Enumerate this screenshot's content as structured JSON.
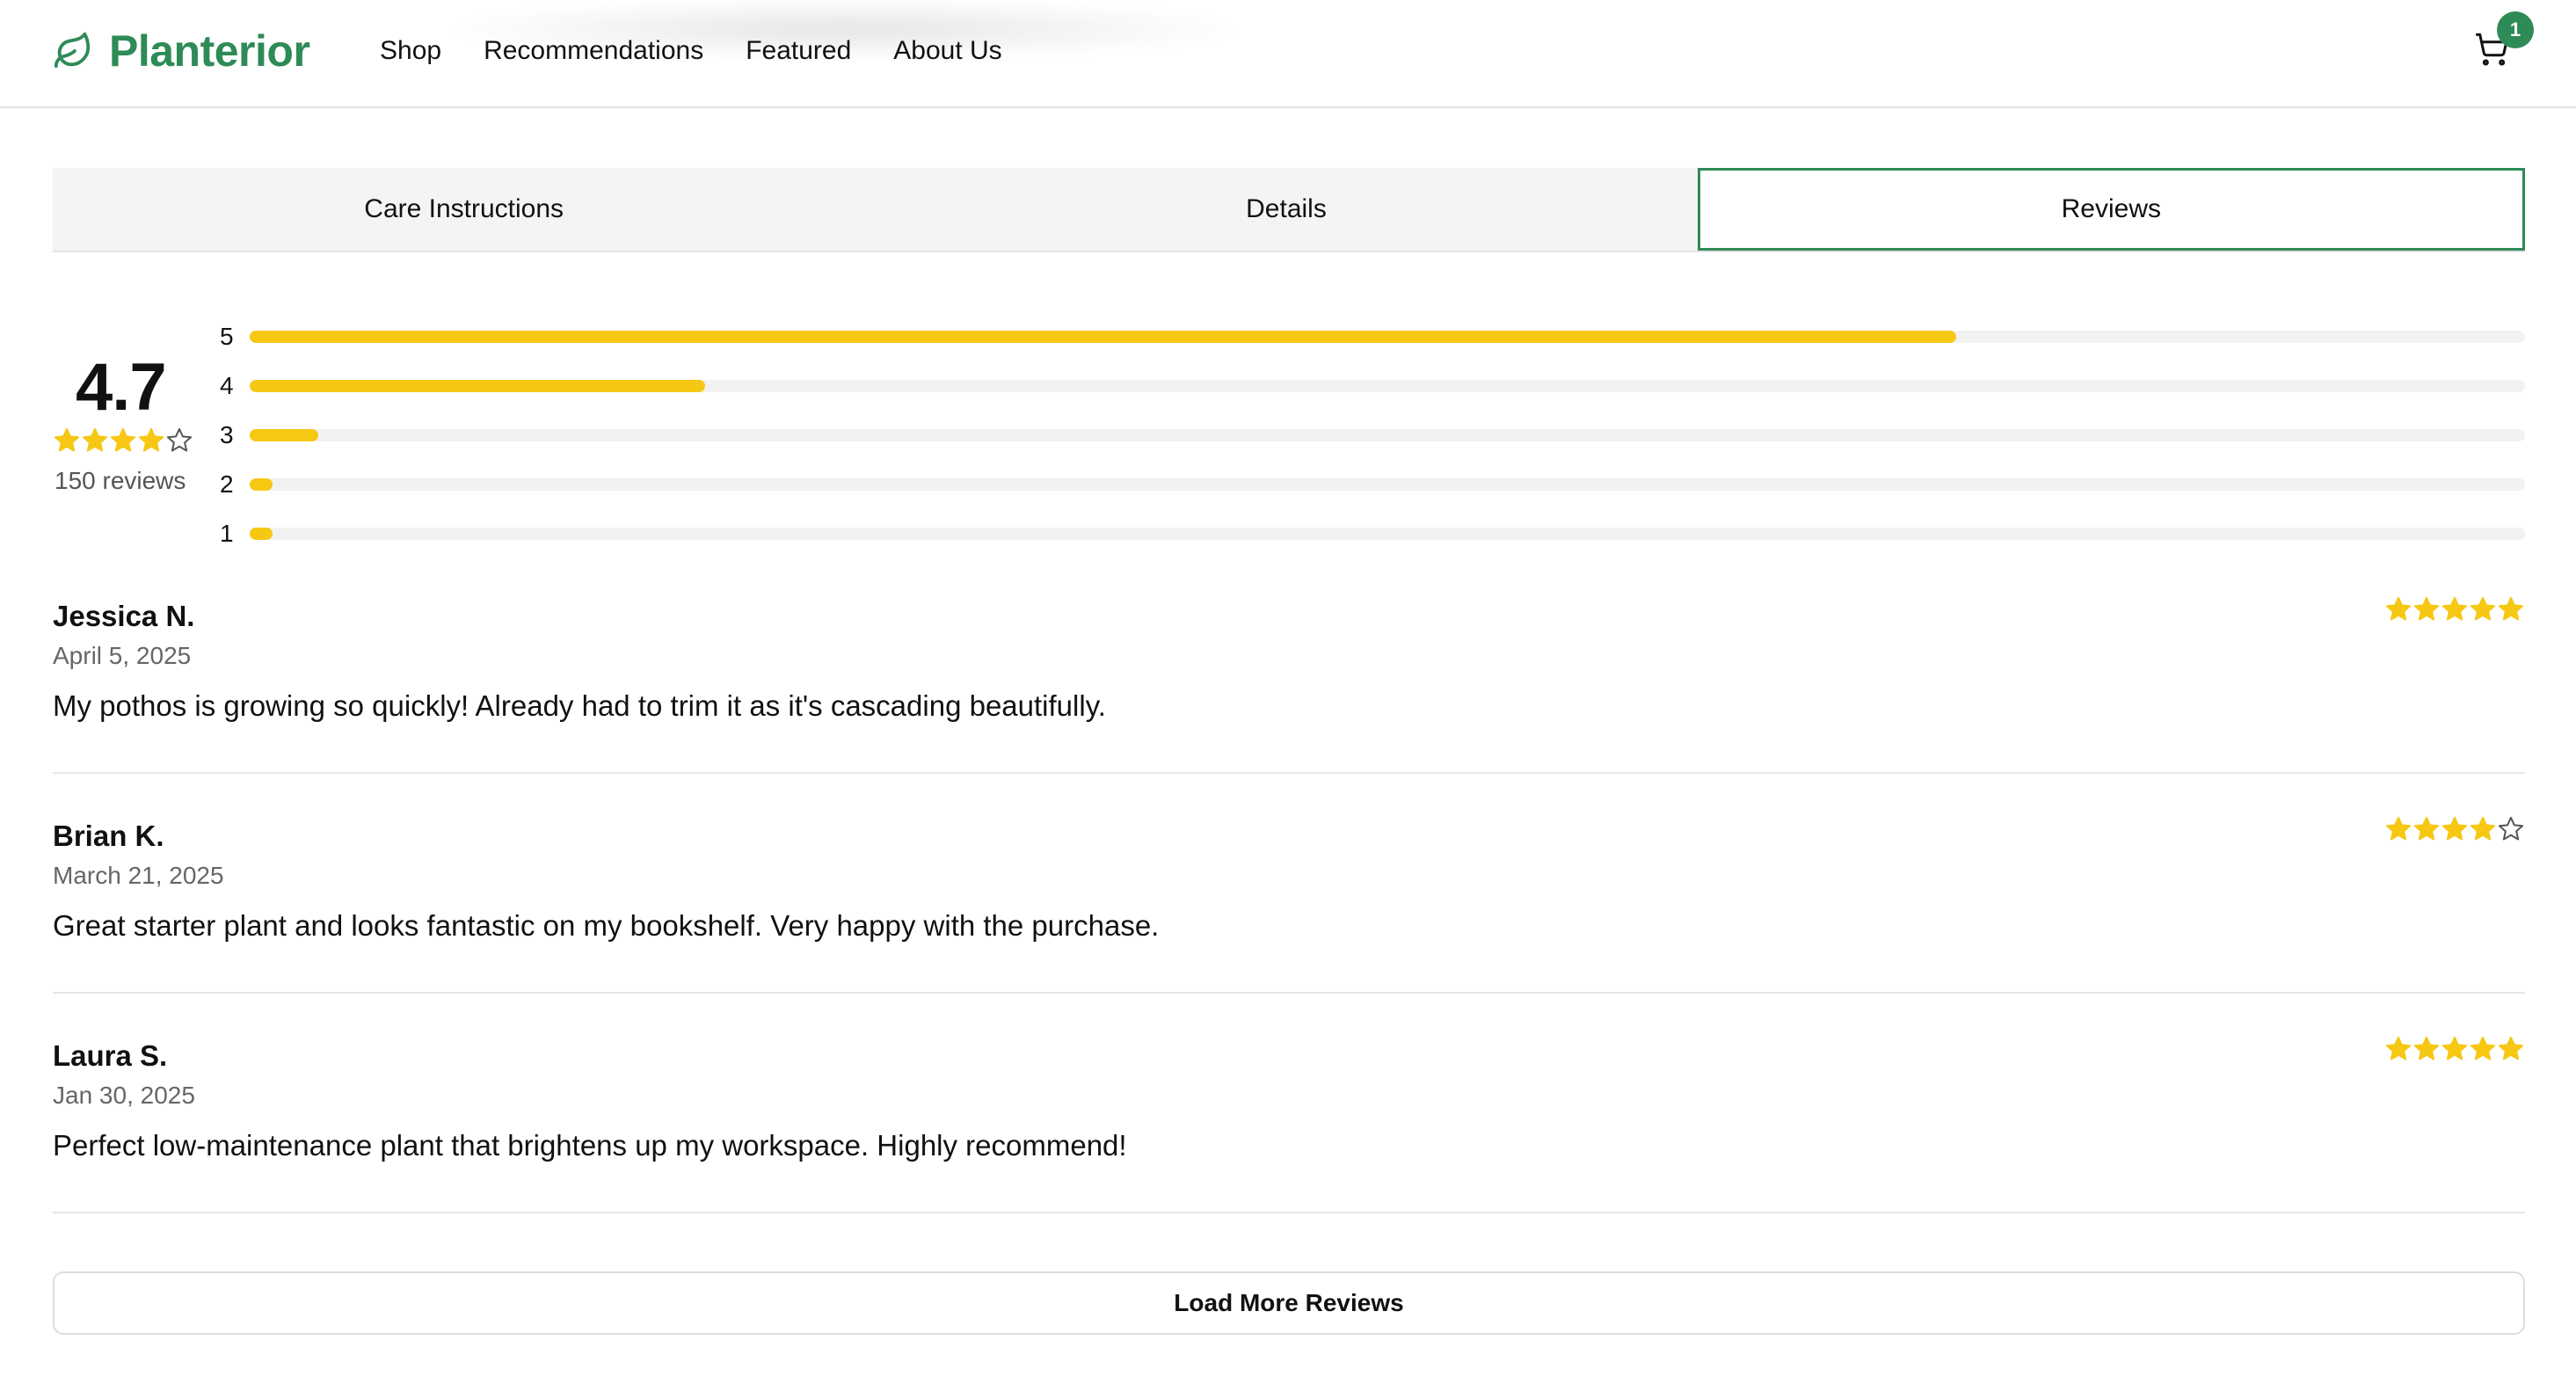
{
  "brand": {
    "name": "Planterior",
    "color": "#2e8b57",
    "icon": "leaf-icon"
  },
  "nav": {
    "items": [
      {
        "label": "Shop"
      },
      {
        "label": "Recommendations"
      },
      {
        "label": "Featured"
      },
      {
        "label": "About Us"
      }
    ]
  },
  "cart": {
    "icon": "cart-icon",
    "count": "1"
  },
  "tabs": {
    "items": [
      {
        "label": "Care Instructions",
        "active": false
      },
      {
        "label": "Details",
        "active": false
      },
      {
        "label": "Reviews",
        "active": true
      }
    ]
  },
  "rating": {
    "average": "4.7",
    "stars": 4,
    "count_label": "150 reviews",
    "star_color": "#f6c814",
    "distribution": [
      {
        "label": "5",
        "fraction": 0.75
      },
      {
        "label": "4",
        "fraction": 0.2
      },
      {
        "label": "3",
        "fraction": 0.03
      },
      {
        "label": "2",
        "fraction": 0.01
      },
      {
        "label": "1",
        "fraction": 0.01
      }
    ]
  },
  "reviews": [
    {
      "name": "Jessica N.",
      "date": "April 5, 2025",
      "text": "My pothos is growing so quickly! Already had to trim it as it's cascading beautifully.",
      "stars": 5
    },
    {
      "name": "Brian K.",
      "date": "March 21, 2025",
      "text": "Great starter plant and looks fantastic on my bookshelf. Very happy with the purchase.",
      "stars": 4
    },
    {
      "name": "Laura S.",
      "date": "Jan 30, 2025",
      "text": "Perfect low-maintenance plant that brightens up my workspace. Highly recommend!",
      "stars": 5
    }
  ],
  "load_more": {
    "label": "Load More Reviews"
  }
}
